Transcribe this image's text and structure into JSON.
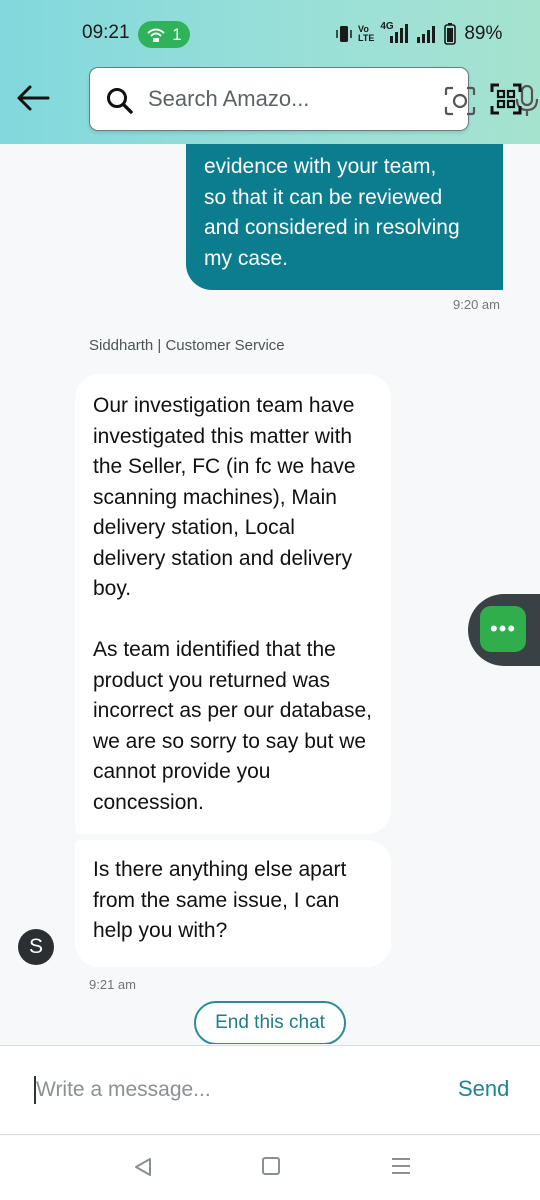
{
  "status_bar": {
    "time": "09:21",
    "hotspot_count": "1",
    "network_labels": [
      "Vo",
      "LTE",
      "4G"
    ],
    "battery": "89%"
  },
  "header": {
    "search_placeholder": "Search Amazo..."
  },
  "chat": {
    "outgoing": {
      "lines": [
        "evidence with your team,",
        "so that it can be reviewed",
        "and considered in resolving",
        "my case."
      ],
      "time": "9:20 am"
    },
    "agent_label": "Siddharth | Customer Service",
    "incoming_1": {
      "paragraph_1": "Our investigation team have investigated this matter with the Seller, FC (in fc we have scanning machines), Main delivery station, Local delivery station and delivery boy.",
      "paragraph_2": "As team identified that the product you returned was incorrect as per our database, we are so sorry to say but we cannot provide you concession."
    },
    "incoming_2": {
      "text": "Is there anything else apart from the same issue, I can help you with?",
      "time": "9:21 am"
    },
    "avatar_letter": "S",
    "end_chat_label": "End this chat"
  },
  "floating_button": {
    "label": "•••"
  },
  "composer": {
    "placeholder": "Write a message...",
    "send_label": "Send"
  },
  "colors": {
    "header_gradient_start": "#82d8dd",
    "header_gradient_end": "#a6e3cf",
    "outgoing_bubble": "#0b7d8f",
    "accent": "#1f8396",
    "float_green": "#2fae4b"
  },
  "icons": [
    "wifi-hotspot-icon",
    "vibrate-icon",
    "signal-icon",
    "battery-icon",
    "back-arrow-icon",
    "search-icon",
    "camera-icon",
    "microphone-icon",
    "qr-scan-icon",
    "more-icon",
    "nav-back-icon",
    "nav-home-icon",
    "nav-menu-icon"
  ]
}
